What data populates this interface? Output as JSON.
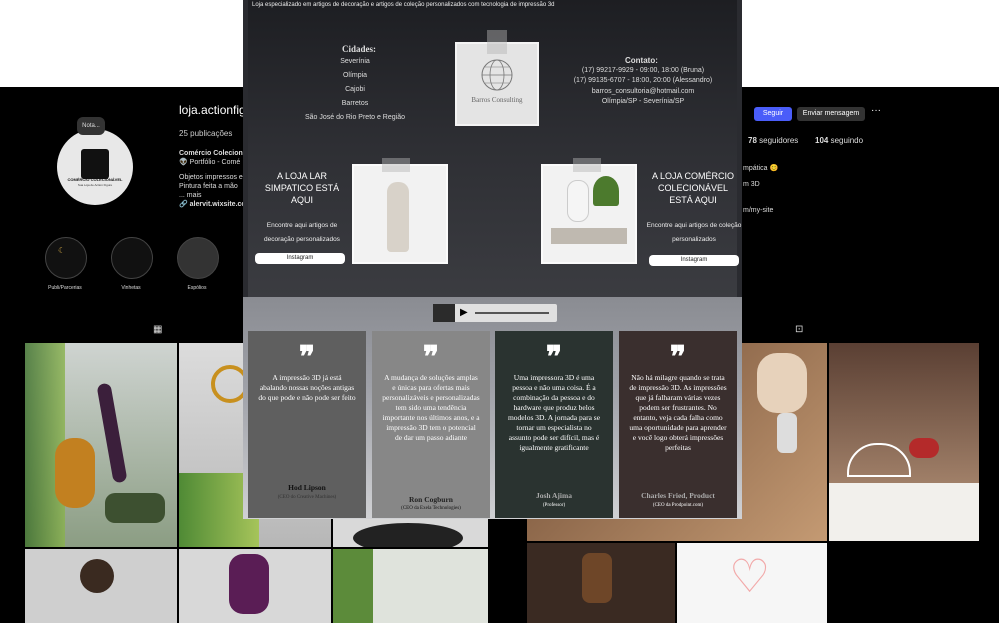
{
  "instagram": {
    "username": "loja.actionfigu",
    "posts": "25 publicações",
    "bio_name": "Comércio Colecion",
    "bio_lines": [
      "👽 Portfólio - Comé",
      "Objetos impressos e",
      "Pintura feita a mão",
      "... mais",
      "🔗 alervit.wixsite.com"
    ],
    "avatar_note": "Nota...",
    "avatar_title": "COMÉRCIO COLECIONÁVEL",
    "avatar_sub": "Sua Loja de Action Figure",
    "highlights": [
      {
        "label": "Publi/Parcerias"
      },
      {
        "label": "Vinhetas"
      },
      {
        "label": "Espólios"
      }
    ],
    "follow_label": "Seguir",
    "message_label": "Enviar mensagem",
    "more_label": "···",
    "followers_count": "78",
    "followers_label": "seguidores",
    "following_count": "104",
    "following_label": "seguindo",
    "right_bio": [
      "mpática 😊",
      "m 3D",
      "m/my-site"
    ],
    "grid_icon": "grid-icon",
    "tagged_icon": "tagged-icon",
    "colors": {
      "follow": "#4a5df9",
      "bg": "#000000"
    }
  },
  "site": {
    "tagline": "Loja especializado em artigos de decoração e artigos de coleção personalizados com tecnologia de impressão 3d",
    "cities_title": "Cidades:",
    "cities": [
      "Severínia",
      "Olímpia",
      "Cajobi",
      "Barretos",
      "São José do Rio Preto e Região"
    ],
    "logo_name": "Barros Consulting",
    "contact_title": "Contato:",
    "contact_lines": [
      "(17) 99217-9929 - 09:00, 18:00 (Bruna)",
      "(17) 99135-6707 - 18:00, 20:00 (Alessandro)",
      "barros_consultoria@hotmail.com",
      "Olímpia/SP - Severínia/SP"
    ],
    "store_left": {
      "title": "A LOJA LAR SIMPATICO ESTÁ AQUI",
      "desc": "Encontre aqui artigos de decoração personalizados",
      "button": "Instagram"
    },
    "store_right": {
      "title": "A LOJA COMÉRCIO COLECIONÁVEL ESTÁ AQUI",
      "desc": "Encontre aqui artigos de coleção personalizados",
      "button": "Instagram"
    },
    "quotes": [
      {
        "text": "A impressão 3D já está abalando nossas noções antigas do que pode e não pode ser feito",
        "name": "Hod Lipson",
        "role": "(CEO do Creative Machines)",
        "bg": "#5f5f5f",
        "name_color": "#111111",
        "role_color": "#333333"
      },
      {
        "text": "A mudança de soluções amplas e únicas para ofertas mais personalizáveis e personalizadas tem sido uma tendência importante nos últimos anos, e a impressão 3D tem o potencial de dar um passo adiante",
        "name": "Ron Cogburn",
        "role": "(CEO da Exela Technologies)",
        "bg": "#878787",
        "name_color": "#222222",
        "role_color": "#111111"
      },
      {
        "text": "Uma impressora 3D é uma pessoa e não uma coisa. É a combinação da pessoa e do hardware que produz belos modelos 3D. A jornada para se tornar um especialista no assunto pode ser difícil, mas é igualmente gratificante",
        "name": "Josh Ajima",
        "role": "(Professor)",
        "bg": "#2a3330",
        "name_color": "#aaaaaa",
        "role_color": "#ffffff"
      },
      {
        "text": "Não há milagre quando se trata de impressão 3D. As impressões que já falharam várias vezes podem ser frustrantes. No entanto, veja cada falha como uma oportunidade para aprender e você logo obterá impressões perfeitas",
        "name": "Charles Fried, Product",
        "role": "(CEO da Prodpoint.com)",
        "bg": "#3a2f2e",
        "name_color": "#aaaaaa",
        "role_color": "#ffffff"
      }
    ],
    "player": {
      "play_icon": "play-icon"
    }
  }
}
